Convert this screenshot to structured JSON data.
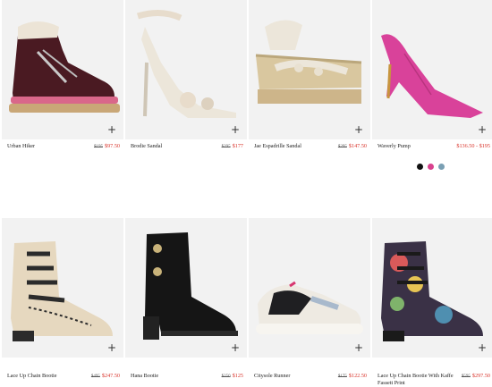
{
  "products": [
    {
      "name": "Urban Hiker",
      "old_price": "$195",
      "price": "$97.50"
    },
    {
      "name": "Brodie Sandal",
      "old_price": "$295",
      "price": "$177"
    },
    {
      "name": "Jae Espadrille Sandal",
      "old_price": "$295",
      "price": "$147.50"
    },
    {
      "name": "Waverly Pump",
      "old_price": "",
      "price": "$136.50 - $195"
    },
    {
      "name": "Lace Up Chain Bootie",
      "old_price": "$495",
      "price": "$247.50"
    },
    {
      "name": "Hana Bootie",
      "old_price": "$250",
      "price": "$125"
    },
    {
      "name": "Citysole Runner",
      "old_price": "$175",
      "price": "$122.50"
    },
    {
      "name": "Lace Up Chain Bootie With Kaffe Fassett Print",
      "old_price": "$595",
      "price": "$297.50"
    }
  ],
  "add_icon": "plus-icon",
  "swatch_colors": [
    "#111111",
    "#d9428e",
    "#7a9fb3"
  ],
  "colors": {
    "sale": "#d9342b",
    "image_bg": "#f2f2f2"
  }
}
